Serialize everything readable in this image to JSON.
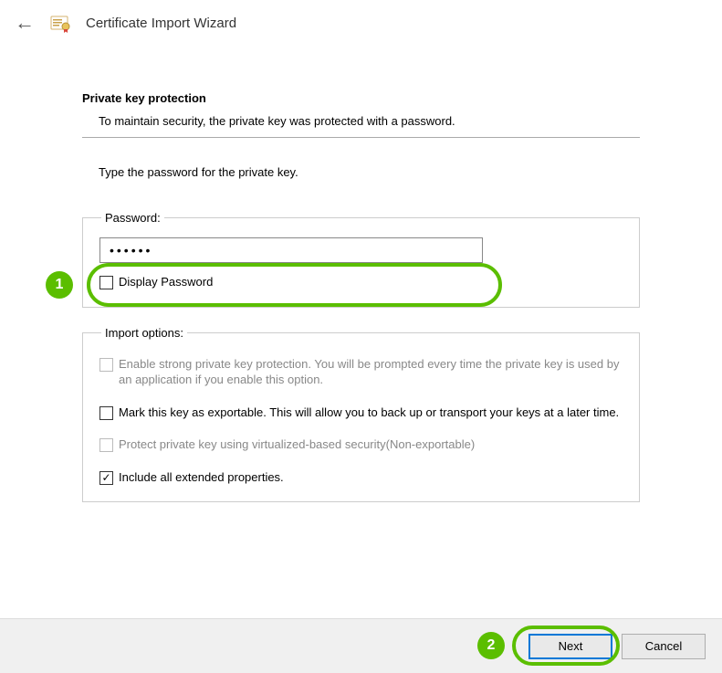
{
  "header": {
    "title": "Certificate Import Wizard"
  },
  "section": {
    "title": "Private key protection",
    "description": "To maintain security, the private key was protected with a password."
  },
  "instruction": "Type the password for the private key.",
  "passwordGroup": {
    "legend": "Password:",
    "value": "••••••",
    "displayPasswordLabel": "Display Password"
  },
  "importOptions": {
    "legend": "Import options:",
    "opt1": "Enable strong private key protection. You will be prompted every time the private key is used by an application if you enable this option.",
    "opt2": "Mark this key as exportable. This will allow you to back up or transport your keys at a later time.",
    "opt3": "Protect private key using virtualized-based security(Non-exportable)",
    "opt4": "Include all extended properties."
  },
  "buttons": {
    "next": "Next",
    "cancel": "Cancel"
  },
  "callouts": {
    "one": "1",
    "two": "2"
  }
}
